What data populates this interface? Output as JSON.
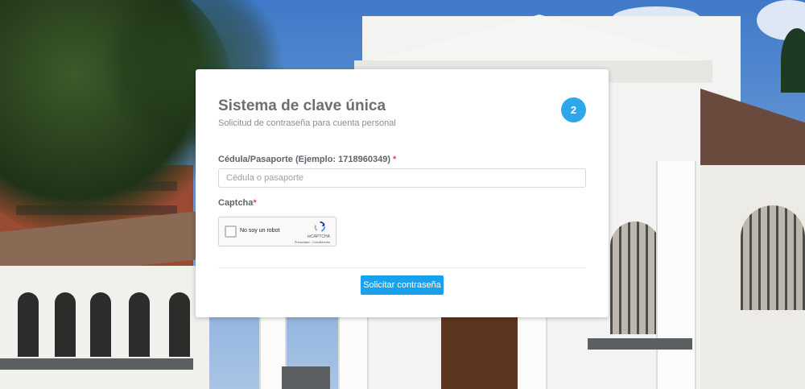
{
  "form": {
    "title": "Sistema de clave única",
    "subtitle": "Solicitud de contraseña para cuenta personal",
    "step_number": "2",
    "id_field": {
      "label": "Cédula/Pasaporte (Ejemplo: 1718960349)",
      "required_mark": "*",
      "placeholder": "Cédula o pasaporte",
      "value": ""
    },
    "captcha": {
      "label": "Captcha",
      "required_mark": "*",
      "checkbox_label": "No soy un robot",
      "brand": "reCAPTCHA",
      "links": "Privacidad - Condiciones"
    },
    "submit_label": "Solicitar contraseña"
  },
  "colors": {
    "accent": "#1aa1ee",
    "step_badge": "#2ea7ea",
    "required": "#e0474c"
  },
  "icons": {
    "recaptcha_logo": "recaptcha-icon"
  }
}
